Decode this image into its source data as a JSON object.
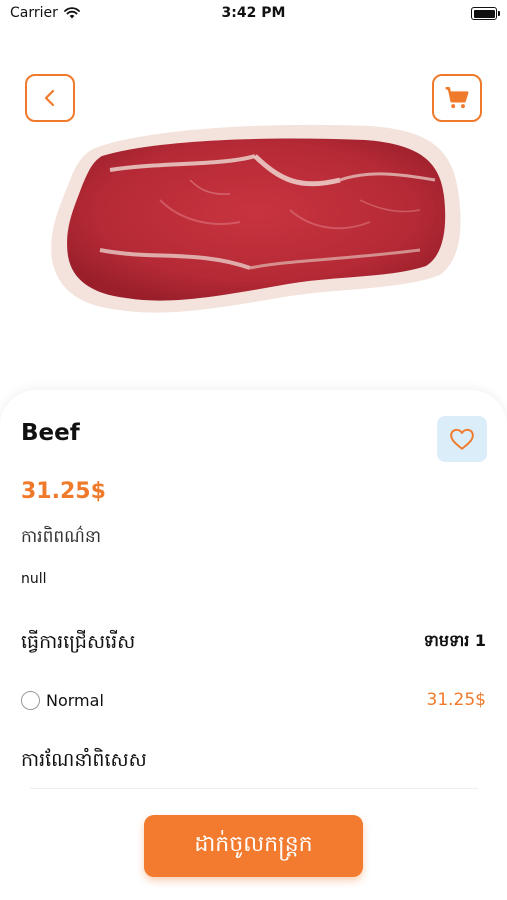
{
  "status_bar": {
    "carrier": "Carrier",
    "time": "3:42 PM"
  },
  "header": {
    "back_icon": "chevron-left-icon",
    "cart_icon": "cart-icon"
  },
  "product": {
    "name": "Beef",
    "price": "31.25$",
    "image": "raw-beef-steak",
    "description_label": "ការពិពណ៌នា",
    "description": "null",
    "favorite_icon": "heart-icon"
  },
  "options": {
    "title": "ធ្វើការជ្រើសរើស",
    "required_label": "ទាមទារ 1",
    "items": [
      {
        "name": "Normal",
        "price": "31.25$",
        "selected": false
      }
    ]
  },
  "special": {
    "label": "ការណែនាំពិសេស"
  },
  "cta": {
    "add_to_cart": "ដាក់ចូលកន្ត្រក"
  },
  "colors": {
    "accent": "#f07a2b",
    "favorite_bg": "#dcedfa"
  }
}
